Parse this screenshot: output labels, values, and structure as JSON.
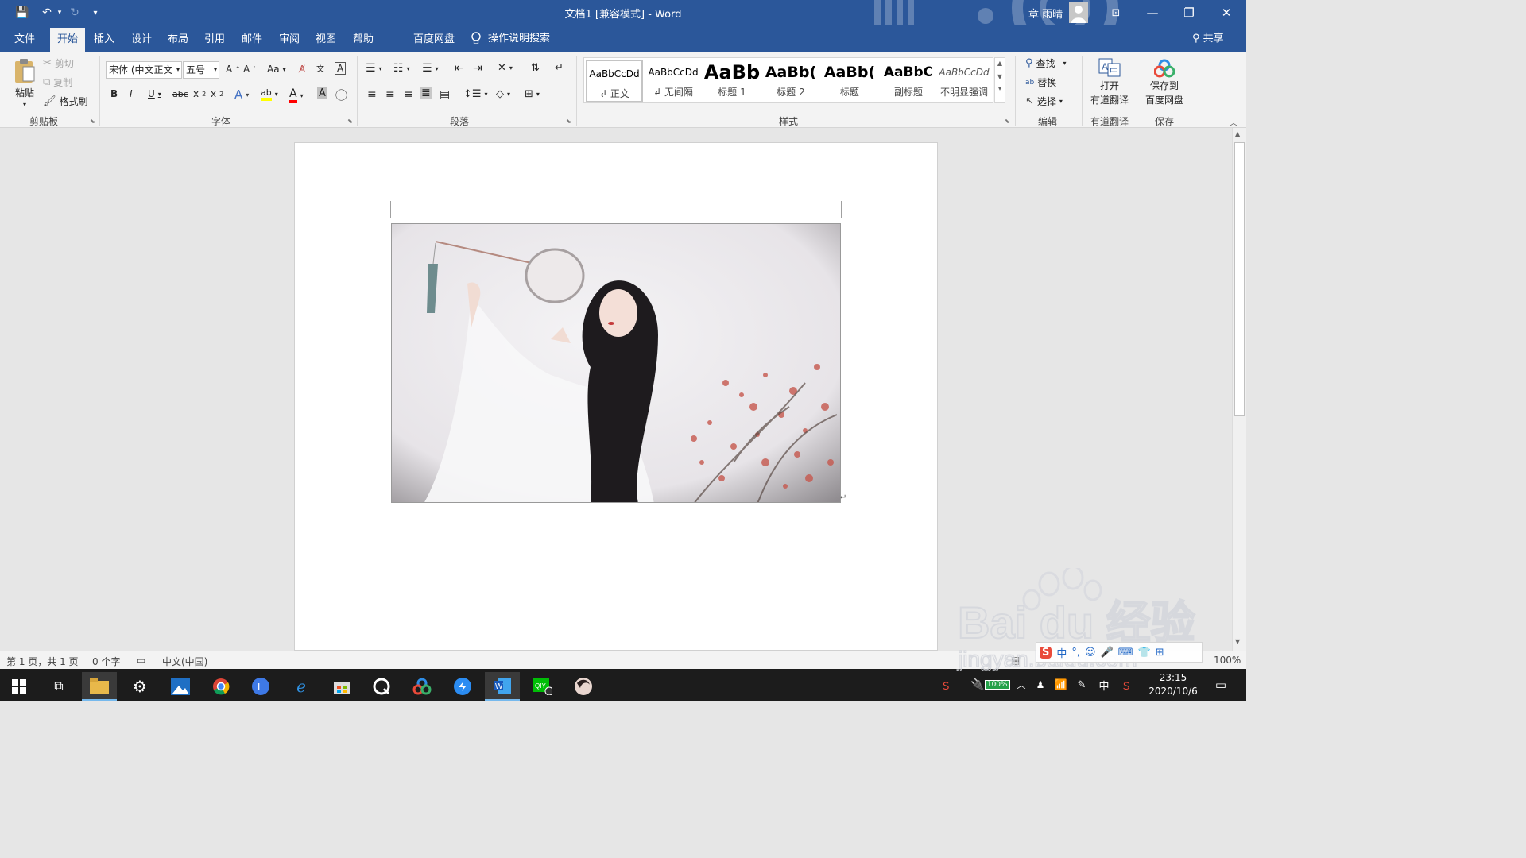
{
  "window": {
    "title": "文档1 [兼容模式]  -  Word",
    "user": "章 雨晴",
    "controls": {
      "restore_ribbon": "⊡",
      "minimize": "—",
      "maximize": "❐",
      "close": "✕"
    }
  },
  "quick_access": {
    "save": "💾",
    "undo": "↶",
    "redo": "↻",
    "customize": "▾"
  },
  "tabs": [
    "文件",
    "开始",
    "插入",
    "设计",
    "布局",
    "引用",
    "邮件",
    "审阅",
    "视图",
    "帮助",
    "百度网盘"
  ],
  "tell_me": "操作说明搜索",
  "share": "共享",
  "ribbon": {
    "clipboard": {
      "label": "剪贴板",
      "paste": "粘贴",
      "cut": "剪切",
      "copy": "复制",
      "format_painter": "格式刷"
    },
    "font": {
      "label": "字体",
      "font_name": "宋体 (中文正文",
      "font_size": "五号"
    },
    "paragraph": {
      "label": "段落"
    },
    "styles": {
      "label": "样式",
      "items": [
        {
          "preview": "AaBbCcDd",
          "name": "↲ 正文"
        },
        {
          "preview": "AaBbCcDd",
          "name": "↲ 无间隔"
        },
        {
          "preview": "AaBb",
          "name": "标题 1"
        },
        {
          "preview": "AaBb(",
          "name": "标题 2"
        },
        {
          "preview": "AaBb(",
          "name": "标题"
        },
        {
          "preview": "AaBbC",
          "name": "副标题"
        },
        {
          "preview": "AaBbCcDd",
          "name": "不明显强调"
        }
      ]
    },
    "editing": {
      "label": "编辑",
      "find": "查找",
      "replace": "替换",
      "select": "选择"
    },
    "youdao": {
      "label": "有道翻译",
      "open": "打开",
      "open2": "有道翻译"
    },
    "save": {
      "label": "保存",
      "save_to": "保存到",
      "save_to2": "百度网盘"
    }
  },
  "status": {
    "page": "第 1 页，共 1 页",
    "words": "0 个字",
    "language": "中文(中国)",
    "zoom": "100%"
  },
  "taskbar": {
    "time": "23:15",
    "date": "2020/10/6",
    "battery": "100%",
    "ime": "中"
  },
  "watermark": {
    "brand": "Bai du 经验",
    "url": "jingyan.baidu.com"
  },
  "colors": {
    "accent": "#2b579a",
    "ribbon_bg": "#f3f3f3",
    "doc_bg": "#e6e6e6",
    "taskbar": "#1c1c1c"
  }
}
